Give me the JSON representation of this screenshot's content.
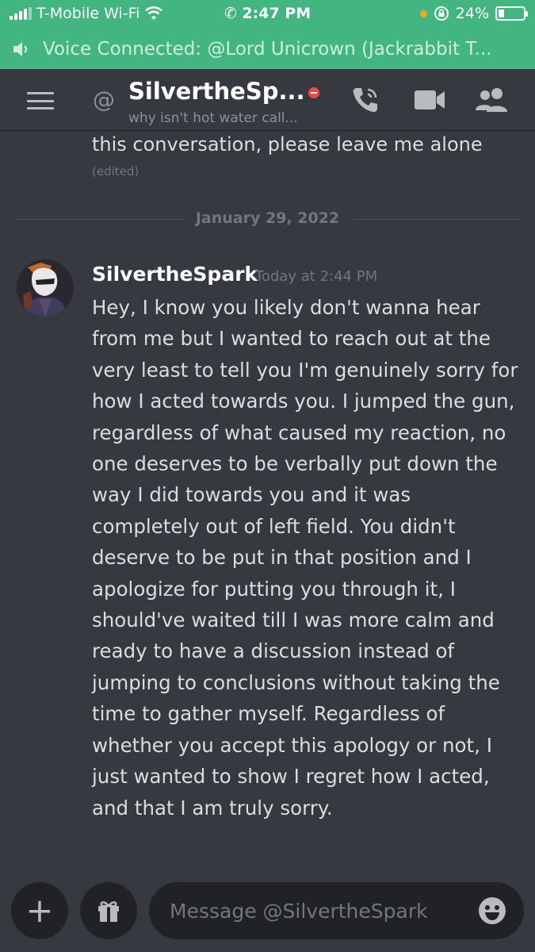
{
  "status_bar": {
    "carrier": "T-Mobile Wi-Fi",
    "time": "2:47 PM",
    "battery": "24%",
    "battery_level": 0.24
  },
  "voice_banner": {
    "text": "Voice Connected: @Lord Unicrown (Jackrabbit T..."
  },
  "header": {
    "title": "SilvertheSp...",
    "subtitle": "why isn't hot water call...",
    "at_symbol": "@"
  },
  "messages": {
    "previous": {
      "text": "this conversation, please leave me alone",
      "edited": "(edited)"
    },
    "date_divider": "January 29, 2022",
    "current": {
      "author": "SilvertheSpark",
      "timestamp": "Today at 2:44 PM",
      "body": "Hey, I know you likely don't wanna hear from me but I wanted to reach out at the very least to tell you I'm genuinely sorry for how I acted towards you. I jumped the gun, regardless of what caused my reaction, no one deserves to be verbally put down the way I did towards you and it was completely out of left field. You didn't deserve to be put in that position and I apologize for putting you through it, I should've waited till I was more calm and ready to have a discussion instead of jumping to conclusions without taking the time to gather myself. Regardless of whether you accept this apology or not, I just wanted to show I regret how I acted, and that I am truly sorry."
    }
  },
  "composer": {
    "placeholder": "Message @SilvertheSpark",
    "plus": "+"
  },
  "colors": {
    "background": "#36393f",
    "banner_green": "#43b581",
    "input_bg": "#202225",
    "dnd_red": "#f04747"
  },
  "icons": [
    "wifi-icon",
    "phone-icon",
    "rotation-lock-icon",
    "speaker-icon",
    "hamburger-menu-icon",
    "call-icon",
    "video-icon",
    "members-icon",
    "gift-icon",
    "emoji-icon"
  ]
}
